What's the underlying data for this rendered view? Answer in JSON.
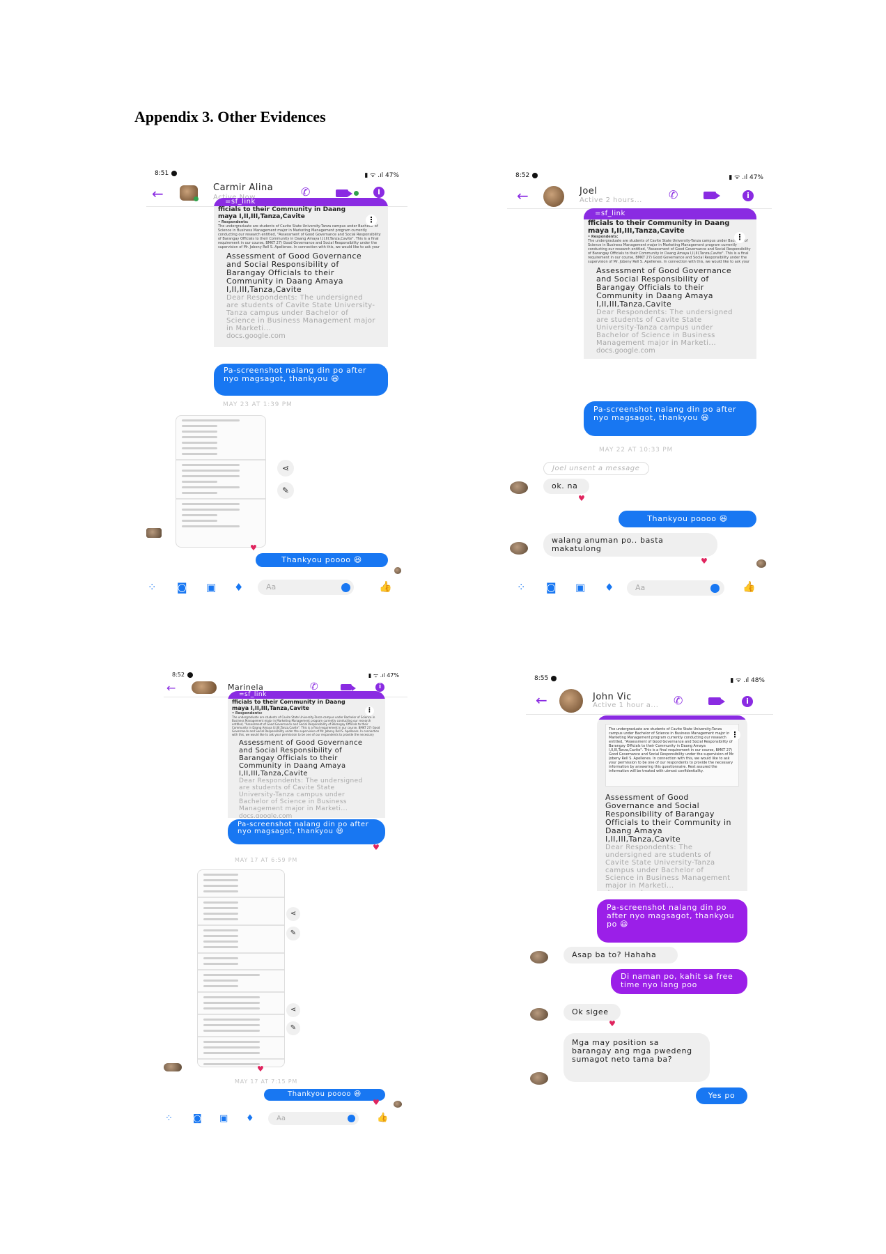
{
  "document": {
    "title": "Appendix 3. Other Evidences"
  },
  "composer": {
    "placeholder": "Aa"
  },
  "link_card": {
    "bar": "=sf_link",
    "heading1": "fficials to their Community in Daang",
    "heading2": "maya I,II,III,Tanza,Cavite",
    "respondents_label": "• Respondents:",
    "small_text": "The undergraduate are students of Cavite State University-Tanza campus under Bachelor of Science in Business Management major in Marketing Management program currently conducting our research entitled, \"Assessment of Good Governance and Social Responsibility of Barangay Officials to their Community in Daang Amaya I,II,III,Tanza,Cavite\". This is a final requirement in our course, BMKT 27) Good Governance and Social Responsibility under the supervision of Mr. Jobeny Rell S. Apellenes. In connection with this, we would like to ask your permission to be one of our respondents to provide the necessary information by answering this questionnaire. Rest assured the information will be treated with utmost confidentiality.",
    "title": "Assessment of Good Governance and Social Responsibility of Barangay Officials to their Community in Daang Amaya I,II,III,Tanza,Cavite",
    "description": "Dear Respondents: The undersigned are students of Cavite State University-Tanza campus under Bachelor of Science in Business Management major in Marketi...",
    "url": "docs.google.com"
  },
  "phones": [
    {
      "status_time": "8:51",
      "status_right": "47%",
      "contact": "Carmir Alina",
      "contact_status": "Active Now",
      "messages": {
        "request": "Pa-screenshot nalang din po after nyo magsagot, thankyou 😆",
        "timestamp": "MAY 23 AT 1:39 PM",
        "thanks": "Thankyou poooo 😆"
      }
    },
    {
      "status_time": "8:52",
      "status_right": "47%",
      "contact": "Joel",
      "contact_status": "Active 2 hours...",
      "messages": {
        "request": "Pa-screenshot nalang din po after nyo magsagot, thankyou 😆",
        "timestamp": "MAY 22 AT 10:33 PM",
        "unsent": "Joel unsent a message",
        "reply1": "ok. na",
        "thanks": "Thankyou poooo 😆",
        "reply2": "walang anuman po.. basta makatulong"
      }
    },
    {
      "status_time": "8:52",
      "status_right": "47%",
      "contact": "Marinela",
      "messages": {
        "request": "Pa-screenshot nalang din po after nyo magsagot, thankyou 😆",
        "timestamp1": "MAY 17 AT 6:59 PM",
        "timestamp2": "MAY 17 AT 7:15 PM",
        "thanks": "Thankyou poooo 😆"
      }
    },
    {
      "status_time": "8:55",
      "status_right": "48%",
      "contact": "John Vic",
      "contact_status": "Active 1 hour a...",
      "messages": {
        "request": "Pa-screenshot nalang din po after nyo magsagot, thankyou po 😆",
        "reply1": "Asap ba to? Hahaha",
        "answer1": "Di naman po, kahit sa free time nyo lang poo",
        "reply2": "Ok sigee",
        "reply3": "Mga may position sa barangay ang mga pwedeng sumagot neto tama ba?",
        "answer2": "Yes po"
      }
    }
  ],
  "colors": {
    "messenger_purple": "#8a2be2",
    "messenger_blue": "#1877f2",
    "heart_red": "#e0245e"
  },
  "icons": [
    "back-arrow-icon",
    "phone-call-icon",
    "video-call-icon",
    "info-icon",
    "apps-icon",
    "camera-icon",
    "gallery-icon",
    "microphone-icon",
    "emoji-icon",
    "thumbs-up-icon",
    "share-icon",
    "pencil-icon",
    "heart-icon"
  ]
}
